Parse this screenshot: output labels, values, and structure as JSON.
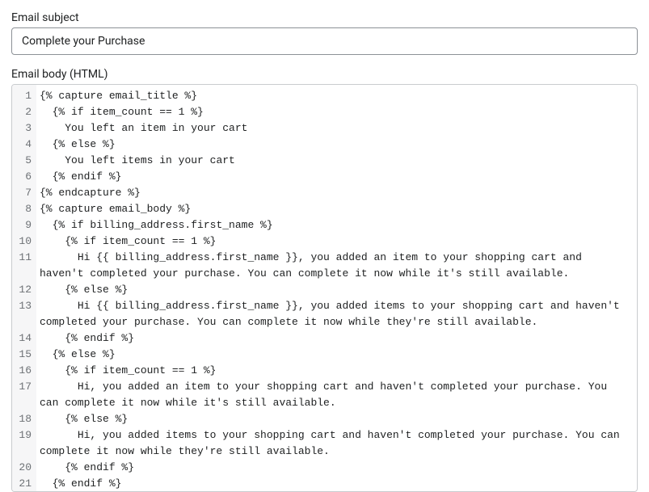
{
  "subject": {
    "label": "Email subject",
    "value": "Complete your Purchase"
  },
  "body": {
    "label": "Email body (HTML)",
    "lines": [
      "{% capture email_title %}",
      "  {% if item_count == 1 %}",
      "    You left an item in your cart",
      "  {% else %}",
      "    You left items in your cart",
      "  {% endif %}",
      "{% endcapture %}",
      "{% capture email_body %}",
      "  {% if billing_address.first_name %}",
      "    {% if item_count == 1 %}",
      "      Hi {{ billing_address.first_name }}, you added an item to your shopping cart and haven't completed your purchase. You can complete it now while it's still available.",
      "    {% else %}",
      "      Hi {{ billing_address.first_name }}, you added items to your shopping cart and haven't completed your purchase. You can complete it now while they're still available.",
      "    {% endif %}",
      "  {% else %}",
      "    {% if item_count == 1 %}",
      "      Hi, you added an item to your shopping cart and haven't completed your purchase. You can complete it now while it's still available.",
      "    {% else %}",
      "      Hi, you added items to your shopping cart and haven't completed your purchase. You can complete it now while they're still available.",
      "    {% endif %}",
      "  {% endif %}"
    ],
    "wrapped_lines": [
      11,
      13,
      17,
      19
    ]
  }
}
